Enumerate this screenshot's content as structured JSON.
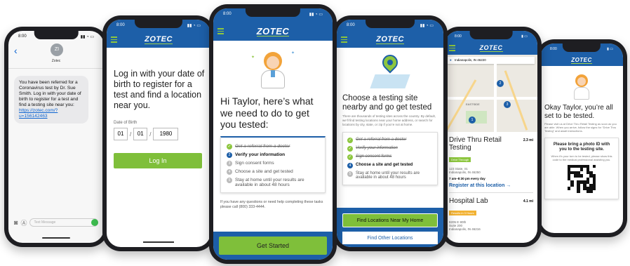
{
  "brand": {
    "logo": "ZOTEC",
    "primary": "#1d5fa8",
    "accent": "#7fbf3a"
  },
  "phone1": {
    "time": "8:00",
    "contact": "Zotec",
    "avatar": "ZI",
    "message_text": "You have been referred for a Coronavirus test by Dr. Sue Smith. Log in with your date of birth to register for a test and find a testing site near you:",
    "message_link": "https://zotec.com/?u=156142463",
    "input_placeholder": "Text Message"
  },
  "phone2": {
    "time": "8:00",
    "heading": "Log in with your date of birth to register for a test and find a location near you.",
    "dob_label": "Date of Birth",
    "month": "01",
    "day": "01",
    "year": "1980",
    "sep1": "/",
    "sep2": "/",
    "login_label": "Log In"
  },
  "phone3": {
    "time": "8:00",
    "heading": "Hi Taylor, here’s what we need to do to get you tested:",
    "steps": [
      {
        "text": "Get a referral from a doctor",
        "state": "done"
      },
      {
        "num": "2",
        "text": "Verify your information",
        "state": "current"
      },
      {
        "num": "3",
        "text": "Sign consent forms",
        "state": "todo"
      },
      {
        "num": "4",
        "text": "Choose a site and get tested",
        "state": "todo"
      },
      {
        "num": "5",
        "text": "Stay at home until your results are available in about 48 hours",
        "state": "todo"
      }
    ],
    "help_text": "If you have any questions or need help completing these tasks please call (800) 333-4444.",
    "cta_label": "Get Started"
  },
  "phone4": {
    "time": "8:00",
    "heading": "Choose a testing site nearby and go get tested",
    "body": "There are thousands of testing sites across the country. By default, we’ll find testing locations near your home address, or search for locations by city, state, or zip if you’re not at home.",
    "steps": [
      {
        "text": "Get a referral from a doctor",
        "state": "done"
      },
      {
        "text": "Verify your information",
        "state": "done"
      },
      {
        "text": "Sign consent forms",
        "state": "done"
      },
      {
        "num": "4",
        "text": "Choose a site and get tested",
        "state": "current"
      },
      {
        "num": "5",
        "text": "Stay at home until your results are available in about 48 hours",
        "state": "todo"
      }
    ],
    "btn_find_near": "Find Locations Near My Home",
    "btn_find_other": "Find Other Locations"
  },
  "phone5": {
    "time": "8:00",
    "search_value": "Indianapolis, IN 46220",
    "map_label": "EASTSIDE",
    "pins": [
      "1",
      "2",
      "3"
    ],
    "loc1": {
      "name": "Drive Thru Retail Testing",
      "distance": "2.3 mi",
      "badge": "Drive Through",
      "address1": "123 State, St.",
      "address2": "Indianapolis, IN 46250",
      "hours": "7 am–8:30 pm every day",
      "register": "Register at this location →"
    },
    "loc2": {
      "name": "Hospital Lab",
      "distance": "4.1 mi",
      "badge": "Results in 3 Hours",
      "address1": "8205 E 80th",
      "address2": "Suite 200",
      "address3": "Indianapolis, IN 46216"
    }
  },
  "phone6": {
    "time": "8:00",
    "heading": "Okay Taylor, you’re all set to be tested.",
    "body": "Please visit us at Drive Thru Retail Testing as soon as you are able. When you arrive, follow the signs for “Drive Thru Testing” and await instructions.",
    "card_title": "Please bring a photo ID with you to the testing site.",
    "card_body": "When it's your turn to be tested, please show this code to the medical professional assisting you."
  }
}
